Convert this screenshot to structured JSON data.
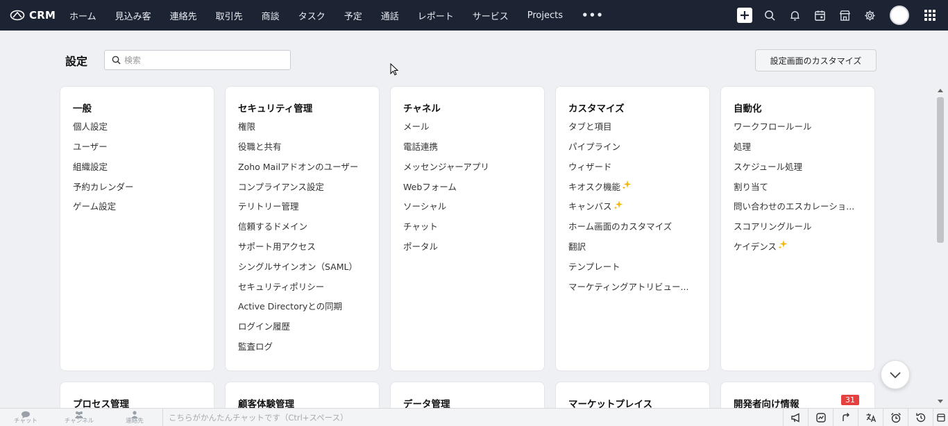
{
  "app": {
    "name": "CRM"
  },
  "nav": {
    "items": [
      "ホーム",
      "見込み客",
      "連絡先",
      "取引先",
      "商談",
      "タスク",
      "予定",
      "通話",
      "レポート",
      "サービス",
      "Projects"
    ],
    "more": "•••"
  },
  "header": {
    "title": "設定",
    "search_placeholder": "検索",
    "customize_label": "設定画面のカスタマイズ"
  },
  "cards": [
    {
      "title": "一般",
      "items": [
        {
          "label": "個人設定"
        },
        {
          "label": "ユーザー"
        },
        {
          "label": "組織設定"
        },
        {
          "label": "予約カレンダー"
        },
        {
          "label": "ゲーム設定"
        }
      ]
    },
    {
      "title": "セキュリティ管理",
      "items": [
        {
          "label": "権限"
        },
        {
          "label": "役職と共有"
        },
        {
          "label": "Zoho Mailアドオンのユーザー"
        },
        {
          "label": "コンプライアンス設定"
        },
        {
          "label": "テリトリー管理"
        },
        {
          "label": "信頼するドメイン"
        },
        {
          "label": "サポート用アクセス"
        },
        {
          "label": "シングルサインオン（SAML）"
        },
        {
          "label": "セキュリティポリシー"
        },
        {
          "label": "Active Directoryとの同期"
        },
        {
          "label": "ログイン履歴"
        },
        {
          "label": "監査ログ"
        }
      ]
    },
    {
      "title": "チャネル",
      "items": [
        {
          "label": "メール"
        },
        {
          "label": "電話連携"
        },
        {
          "label": "メッセンジャーアプリ"
        },
        {
          "label": "Webフォーム"
        },
        {
          "label": "ソーシャル"
        },
        {
          "label": "チャット"
        },
        {
          "label": "ポータル"
        }
      ]
    },
    {
      "title": "カスタマイズ",
      "items": [
        {
          "label": "タブと項目"
        },
        {
          "label": "パイプライン"
        },
        {
          "label": "ウィザード"
        },
        {
          "label": "キオスク機能",
          "new": true
        },
        {
          "label": "キャンバス",
          "new": true
        },
        {
          "label": "ホーム画面のカスタマイズ"
        },
        {
          "label": "翻訳"
        },
        {
          "label": "テンプレート"
        },
        {
          "label": "マーケティングアトリビュー..."
        }
      ]
    },
    {
      "title": "自動化",
      "items": [
        {
          "label": "ワークフロールール"
        },
        {
          "label": "処理"
        },
        {
          "label": "スケジュール処理"
        },
        {
          "label": "割り当て"
        },
        {
          "label": "問い合わせのエスカレーショ..."
        },
        {
          "label": "スコアリングルール"
        },
        {
          "label": "ケイデンス",
          "new": true
        }
      ]
    }
  ],
  "cards_row2": [
    {
      "title": "プロセス管理"
    },
    {
      "title": "顧客体験管理"
    },
    {
      "title": "データ管理"
    },
    {
      "title": "マーケットプレイス"
    },
    {
      "title": "開発者向け情報",
      "badge": "31"
    }
  ],
  "bottom": {
    "tabs": [
      "チャット",
      "チャンネル",
      "連絡先"
    ],
    "chat_placeholder": "こちらがかんたんチャットです（Ctrl+スペース）"
  },
  "colors": {
    "topbar": "#1c2333",
    "badge": "#e54141",
    "sparkle": "#f2b705"
  }
}
